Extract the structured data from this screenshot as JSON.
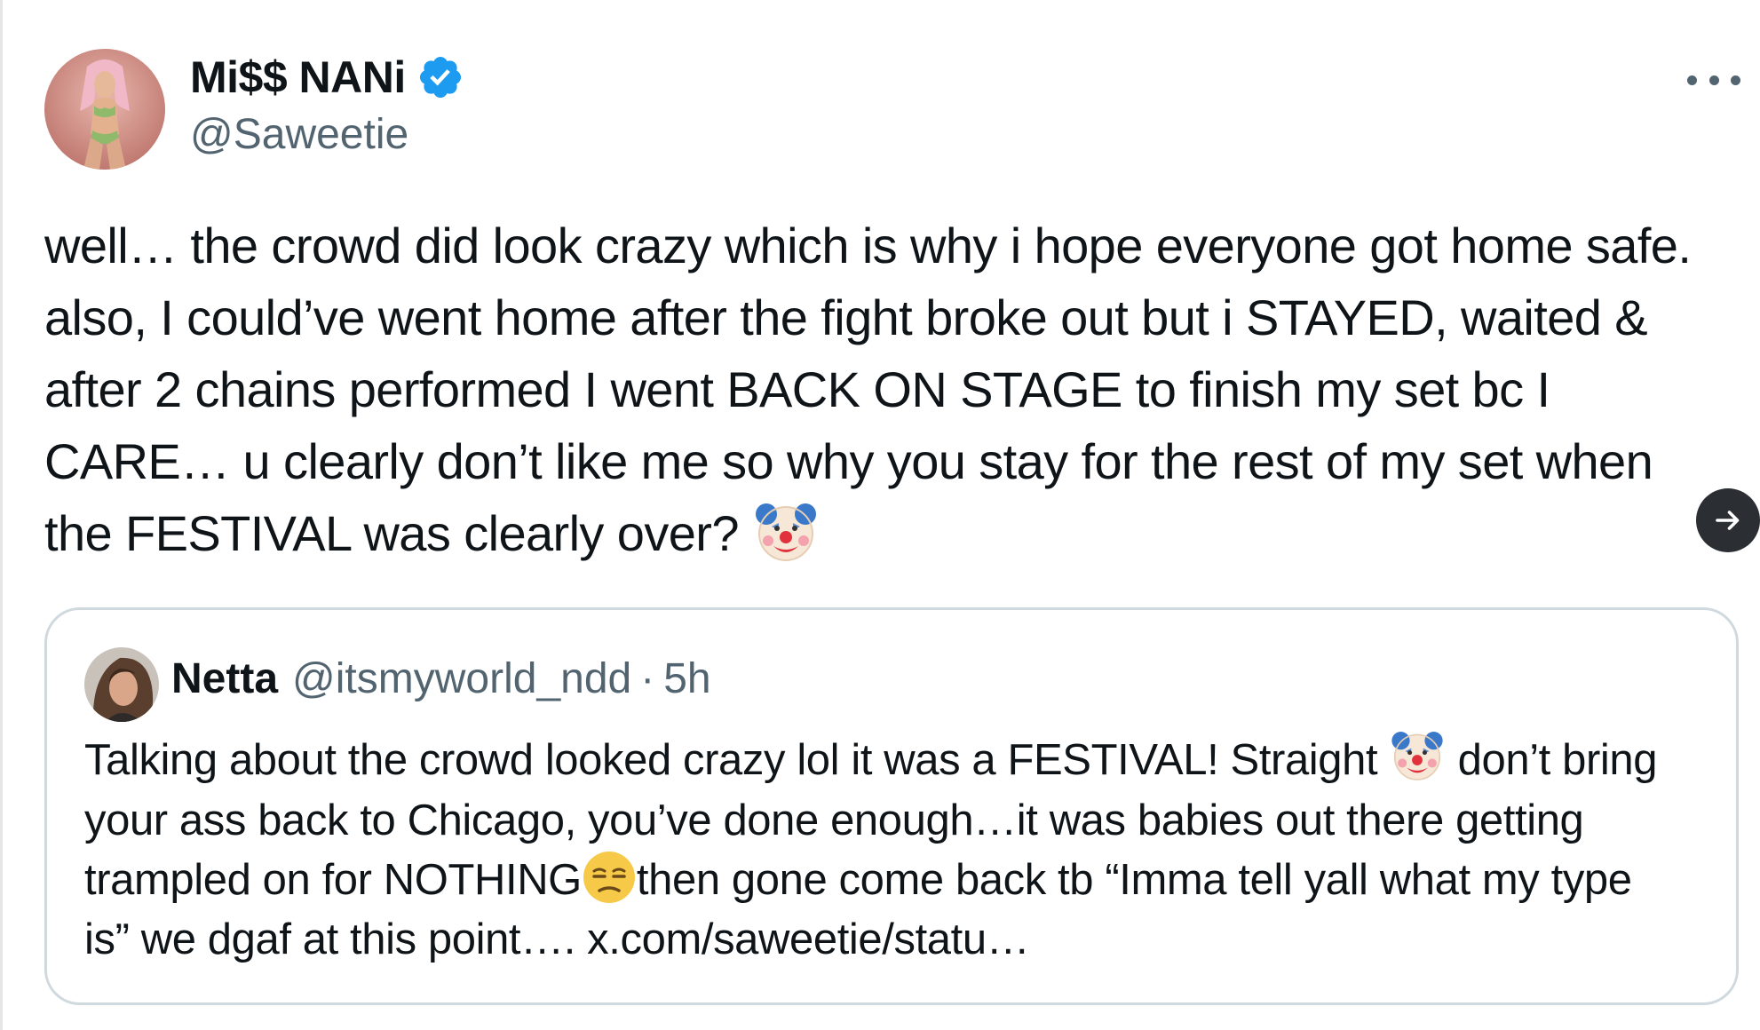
{
  "tweet": {
    "display_name": "Mi$$ NANi",
    "handle": "@Saweetie",
    "text_part1": "well… the crowd did look crazy which is why i hope everyone got home safe. also, I could’ve went home after the fight broke out but i STAYED, waited & after 2 chains performed I went BACK ON STAGE to finish my set bc I CARE… u clearly don’t like me so why you stay for the rest of my set when the FESTIVAL was clearly over? ",
    "emoji_1": "clown-face-emoji",
    "verified_icon": "verified-badge-icon",
    "more_icon": "more-options-icon",
    "next_icon": "arrow-right-icon"
  },
  "quote": {
    "name": "Netta",
    "handle": "@itsmyworld_ndd",
    "dot": "·",
    "time": "5h",
    "text_part1": "Talking about the crowd looked crazy lol it was a FESTIVAL! Straight ",
    "emoji_1": "clown-face-emoji",
    "text_part2": " don’t bring your ass back to Chicago, you’ve done enough…it was babies out there getting trampled on for NOTHING",
    "emoji_2": "unamused-face-emoji",
    "text_part3": "then gone come back tb “Imma tell yall what my type is” we dgaf at this point…. x.com/saweetie/statu…"
  },
  "colors": {
    "text_primary": "#0f1419",
    "text_secondary": "#536471",
    "verified_blue": "#1d9bf0",
    "card_border": "#cfd9de",
    "next_button_bg": "#2b2f33"
  }
}
